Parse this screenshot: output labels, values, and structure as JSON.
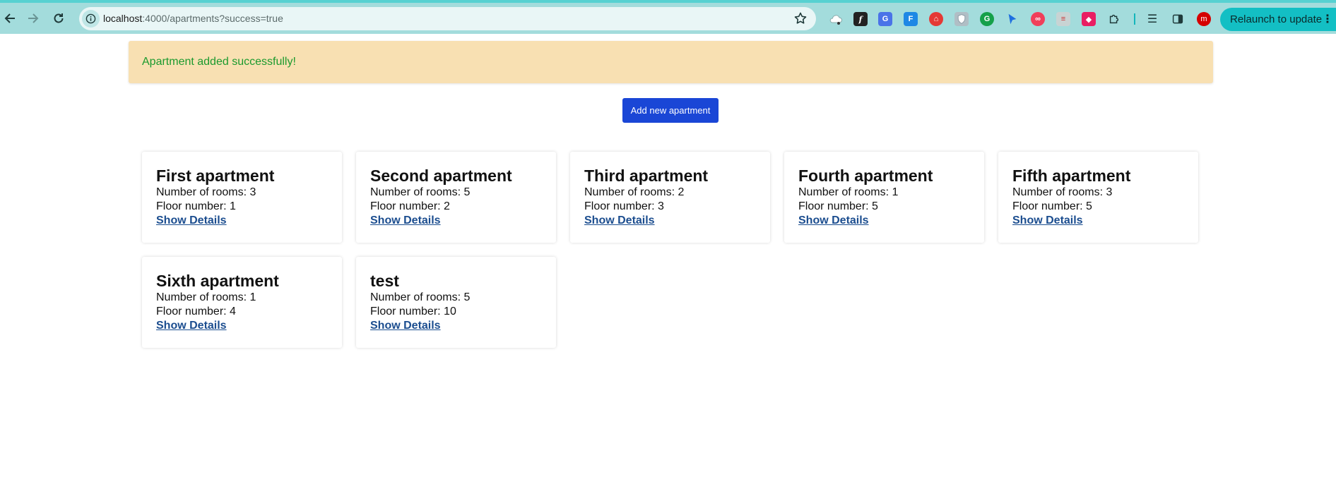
{
  "browser": {
    "url_host": "localhost",
    "url_rest": ":4000/apartments?success=true",
    "relaunch_label": "Relaunch to update",
    "profile_initial": "m",
    "accent_color": "#a3dcdc"
  },
  "alert": {
    "message": "Apartment added successfully!",
    "background": "#f8e0b2",
    "text_color": "#1b9a2e"
  },
  "actions": {
    "add_label": "Add new apartment",
    "button_color": "#1a46d6"
  },
  "rooms_label": "Number of rooms: ",
  "floor_label": "Floor number: ",
  "details_label": "Show Details",
  "apartments": [
    {
      "name": "First apartment",
      "rooms": "3",
      "floor": "1"
    },
    {
      "name": "Second apartment",
      "rooms": "5",
      "floor": "2"
    },
    {
      "name": "Third apartment",
      "rooms": "2",
      "floor": "3"
    },
    {
      "name": "Fourth apartment",
      "rooms": "1",
      "floor": "5"
    },
    {
      "name": "Fifth apartment",
      "rooms": "3",
      "floor": "5"
    },
    {
      "name": "Sixth apartment",
      "rooms": "1",
      "floor": "4"
    },
    {
      "name": "test",
      "rooms": "5",
      "floor": "10"
    }
  ]
}
